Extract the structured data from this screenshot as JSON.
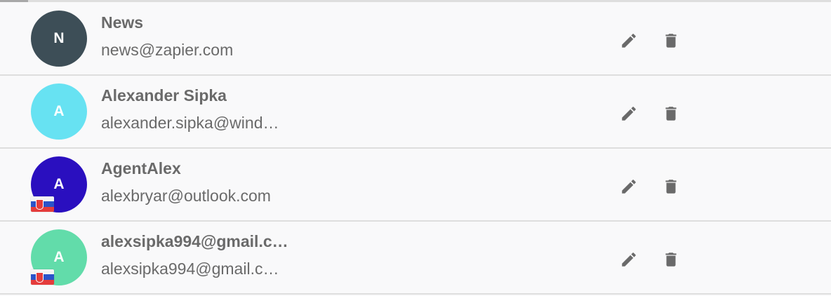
{
  "colors": {
    "text": "#6a6a6a",
    "icon": "#6a6a6a",
    "divider": "#dedede",
    "background": "#f9f9fa"
  },
  "contacts": [
    {
      "initial": "N",
      "name": "News",
      "email": "news@zapier.com",
      "avatar_color": "#3d4e57",
      "flag": null
    },
    {
      "initial": "A",
      "name": "Alexander Sipka",
      "email": "alexander.sipka@wind…",
      "avatar_color": "#67e2f2",
      "flag": null
    },
    {
      "initial": "A",
      "name": "AgentAlex",
      "email": "alexbryar@outlook.com",
      "avatar_color": "#2a0fbf",
      "flag": "slovakia-flag-icon"
    },
    {
      "initial": "A",
      "name": "alexsipka994@gmail.c…",
      "email": "alexsipka994@gmail.c…",
      "avatar_color": "#62dcaa",
      "flag": "slovakia-flag-icon"
    }
  ],
  "icons": {
    "edit": "pencil-icon",
    "delete": "trash-icon"
  }
}
